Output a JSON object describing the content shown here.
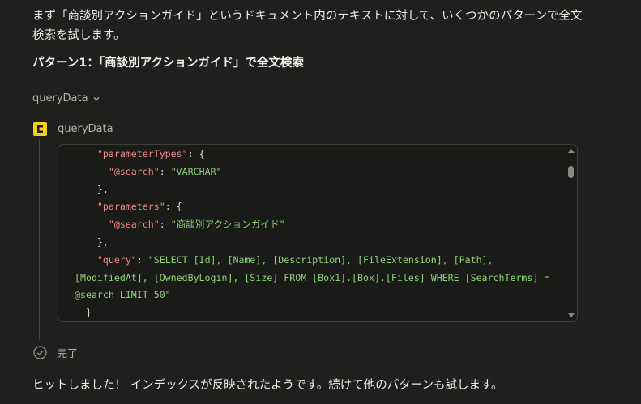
{
  "message": {
    "intro": "まず「商談別アクションガイド」というドキュメント内のテキストに対して、いくつかのパターンで全文検索を試します。",
    "heading": "パターン1：「商談別アクションガイド」で全文検索"
  },
  "tool_call": {
    "toggle_label": "queryData",
    "name": "queryData",
    "status": "完了",
    "code": {
      "parameter_types_key": "\"parameterTypes\"",
      "search_key": "\"@search\"",
      "search_type": "\"VARCHAR\"",
      "parameters_key": "\"parameters\"",
      "search_value": "\"商談別アクションガイド\"",
      "query_key": "\"query\"",
      "query_value": "\"SELECT [Id], [Name], [Description], [FileExtension], [Path], [ModifiedAt], [OwnedByLogin], [Size] FROM [Box1].[Box].[Files] WHERE [SearchTerms] = @search LIMIT 50\""
    }
  },
  "result_text": "ヒットしました！ インデックスが反映されたようです。続けて他のパターンも試します。",
  "colors": {
    "background": "#1f1f1e",
    "tool_icon": "#f2d21b",
    "json_key": "#ef8a85",
    "json_string": "#8fd377"
  },
  "icons": {
    "toggle": "chevron-down-icon",
    "tool": "connector-logo-icon",
    "status": "check-circle-icon"
  }
}
